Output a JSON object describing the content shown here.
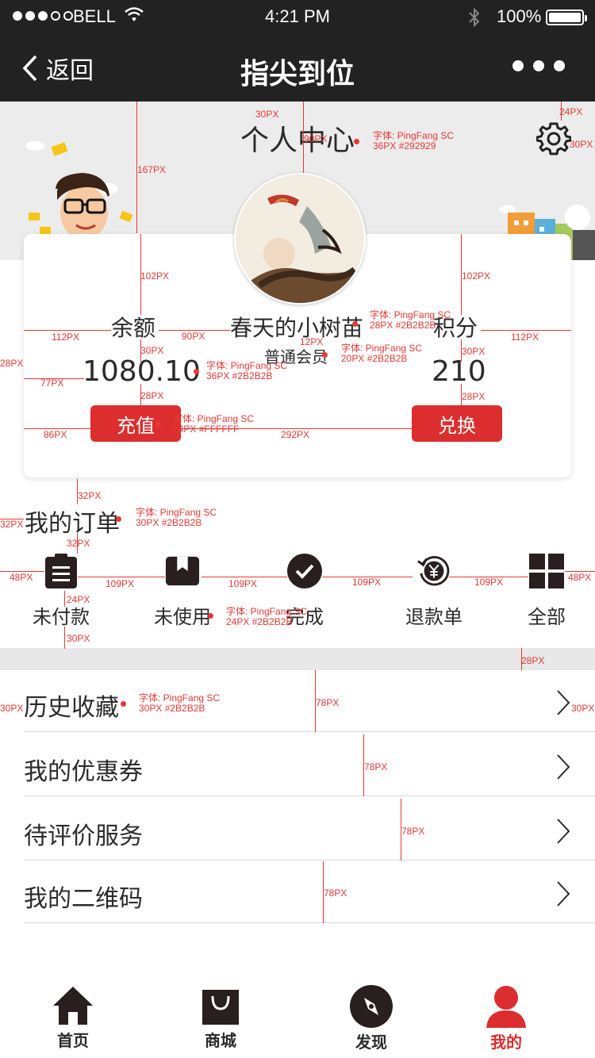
{
  "status_bar": {
    "carrier": "BELL",
    "time": "4:21 PM",
    "battery": "100%"
  },
  "navbar": {
    "back_label": "返回",
    "title": "指尖到位"
  },
  "header": {
    "page_title": "个人中心"
  },
  "profile": {
    "balance_label": "余额",
    "balance_value": "1080.10",
    "recharge_label": "充值",
    "username": "春天的小树苗",
    "member_level": "普通会员",
    "points_label": "积分",
    "points_value": "210",
    "exchange_label": "兑换"
  },
  "orders": {
    "title": "我的订单",
    "items": [
      {
        "label": "未付款",
        "icon": "clipboard-icon"
      },
      {
        "label": "未使用",
        "icon": "package-icon"
      },
      {
        "label": "完成",
        "icon": "check-circle-icon"
      },
      {
        "label": "退款单",
        "icon": "refund-yen-icon"
      },
      {
        "label": "全部",
        "icon": "grid-icon"
      }
    ]
  },
  "menu": [
    {
      "label": "历史收藏"
    },
    {
      "label": "我的优惠券"
    },
    {
      "label": "待评价服务"
    },
    {
      "label": "我的二维码"
    }
  ],
  "tabbar": {
    "items": [
      {
        "label": "首页",
        "icon": "home-icon"
      },
      {
        "label": "商城",
        "icon": "shopping-bag-icon"
      },
      {
        "label": "发现",
        "icon": "compass-icon"
      },
      {
        "label": "我的",
        "icon": "user-icon"
      }
    ],
    "active_index": 3
  },
  "colors": {
    "accent": "#dc2e2e",
    "text": "#2b2b2b",
    "bar": "#222222",
    "title": "#292929"
  },
  "annotations": {
    "a_30px": "30PX",
    "a_24px": "24PX",
    "a_167px": "167PX",
    "a_90px": "90PX",
    "a_102px": "102PX",
    "a_112px": "112PX",
    "a_28px": "28PX",
    "a_77px": "77PX",
    "a_86px": "86PX",
    "a_292px": "292PX",
    "a_12px": "12PX",
    "a_32px": "32PX",
    "a_48px": "48PX",
    "a_109px": "109PX",
    "a_78px": "78PX",
    "font": "字体: PingFang SC",
    "spec_title": "36PX #292929",
    "spec_name": "28PX #2B2B2B",
    "spec_level": "20PX #2B2B2B",
    "spec_num": "36PX #2B2B2B",
    "spec_btn": "24PX #FFFFFF",
    "spec_section": "30PX #2B2B2B",
    "spec_order": "24PX #2B2B2B",
    "spec_row": "30PX #2B2B2B"
  }
}
